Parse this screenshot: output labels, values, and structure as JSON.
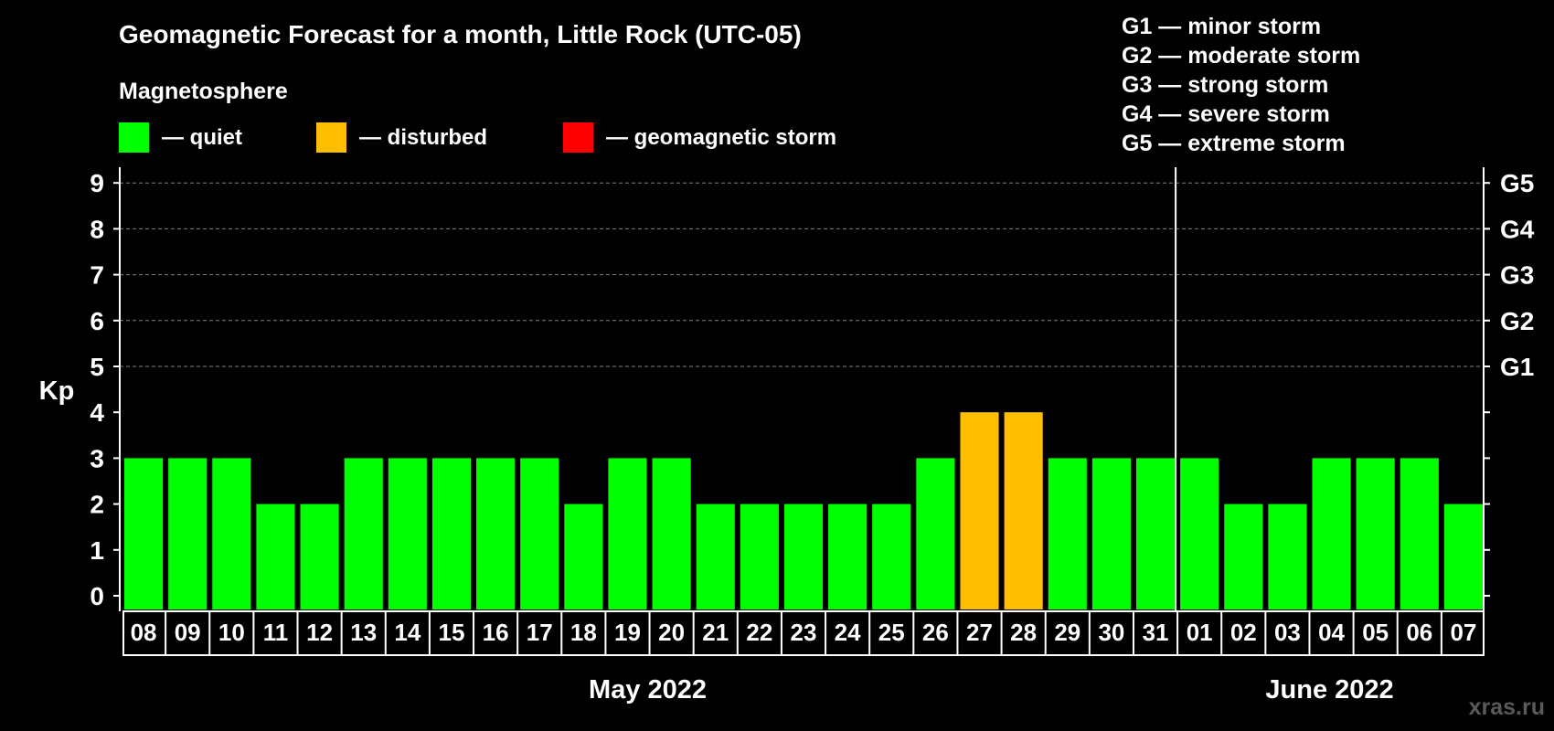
{
  "chart_data": {
    "type": "bar",
    "title": "Geomagnetic Forecast for a month, Little Rock (UTC-05)",
    "ylabel": "Kp",
    "ylim": [
      0,
      9
    ],
    "yticks": [
      "0",
      "1",
      "2",
      "3",
      "4",
      "5",
      "6",
      "7",
      "8",
      "9"
    ],
    "grid": "dashed horizontal at 5-9",
    "categories": [
      "08",
      "09",
      "10",
      "11",
      "12",
      "13",
      "14",
      "15",
      "16",
      "17",
      "18",
      "19",
      "20",
      "21",
      "22",
      "23",
      "24",
      "25",
      "26",
      "27",
      "28",
      "29",
      "30",
      "31",
      "01",
      "02",
      "03",
      "04",
      "05",
      "06",
      "07"
    ],
    "values": [
      3,
      3,
      3,
      2,
      2,
      3,
      3,
      3,
      3,
      3,
      2,
      3,
      3,
      2,
      2,
      2,
      2,
      2,
      3,
      4,
      4,
      3,
      3,
      3,
      3,
      2,
      2,
      3,
      3,
      3,
      2
    ],
    "levels": [
      "quiet",
      "quiet",
      "quiet",
      "quiet",
      "quiet",
      "quiet",
      "quiet",
      "quiet",
      "quiet",
      "quiet",
      "quiet",
      "quiet",
      "quiet",
      "quiet",
      "quiet",
      "quiet",
      "quiet",
      "quiet",
      "quiet",
      "disturbed",
      "disturbed",
      "quiet",
      "quiet",
      "quiet",
      "quiet",
      "quiet",
      "quiet",
      "quiet",
      "quiet",
      "quiet",
      "quiet"
    ],
    "months": [
      {
        "label": "May 2022",
        "start": 0,
        "end": 23
      },
      {
        "label": "June 2022",
        "start": 24,
        "end": 30
      }
    ],
    "month_divider_after": 23,
    "right_axis": [
      {
        "kp": 5,
        "label": "G1"
      },
      {
        "kp": 6,
        "label": "G2"
      },
      {
        "kp": 7,
        "label": "G3"
      },
      {
        "kp": 8,
        "label": "G4"
      },
      {
        "kp": 9,
        "label": "G5"
      }
    ],
    "legend": {
      "heading": "Magnetosphere",
      "items": [
        {
          "key": "quiet",
          "label": "— quiet",
          "color": "#00ff00"
        },
        {
          "key": "disturbed",
          "label": "— disturbed",
          "color": "#ffbf00"
        },
        {
          "key": "storm",
          "label": "— geomagnetic storm",
          "color": "#ff0000"
        }
      ]
    },
    "storm_scale": [
      "G1 — minor storm",
      "G2 — moderate storm",
      "G3 — strong storm",
      "G4 — severe storm",
      "G5 — extreme storm"
    ]
  },
  "watermark": "xras.ru",
  "colors": {
    "background": "#000000",
    "axis": "#ffffff",
    "grid": "#808080"
  }
}
